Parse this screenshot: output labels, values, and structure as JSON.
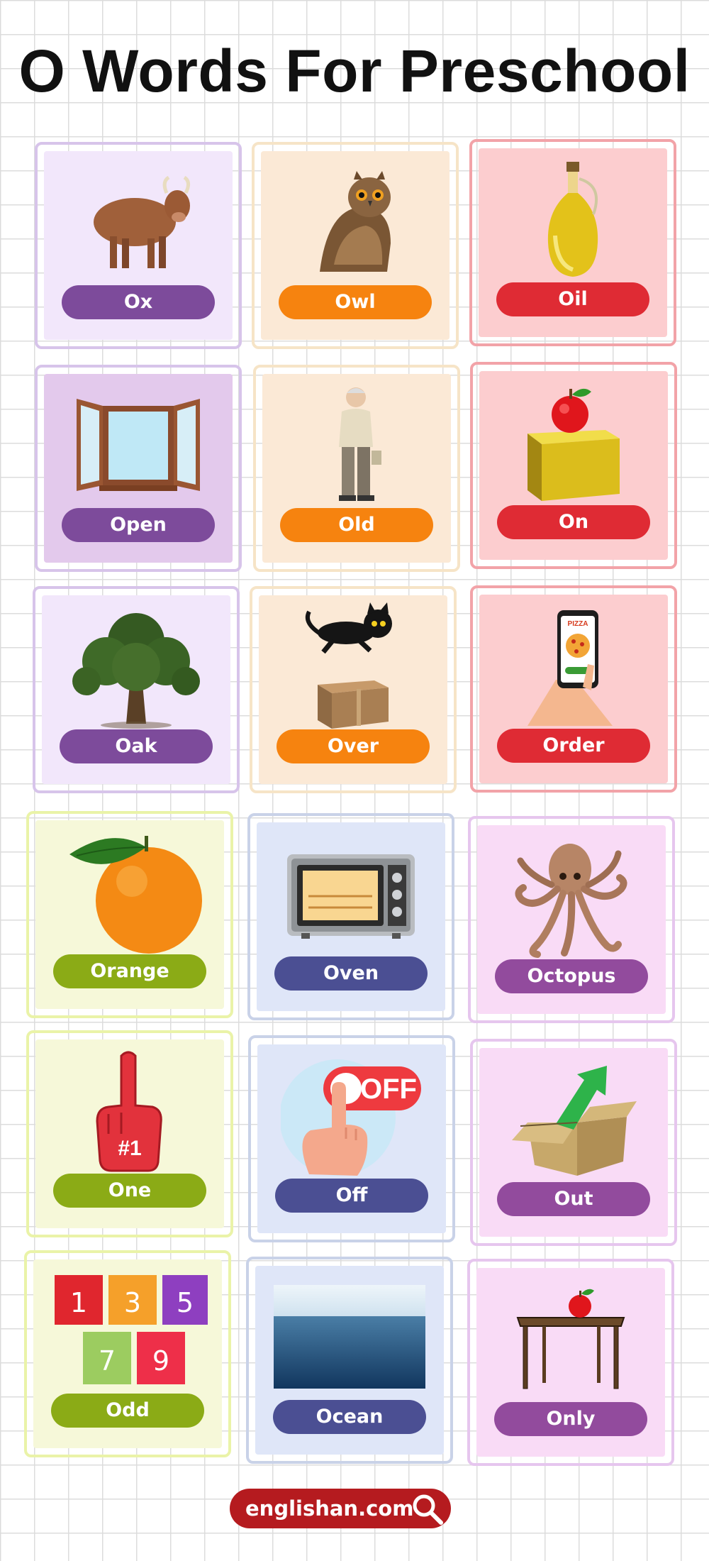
{
  "title": "O Words For Preschool",
  "cards": [
    {
      "word": "Ox",
      "icon": "ox-icon",
      "theme": "purple"
    },
    {
      "word": "Owl",
      "icon": "owl-icon",
      "theme": "peach"
    },
    {
      "word": "Oil",
      "icon": "oil-bottle-icon",
      "theme": "red"
    },
    {
      "word": "Open",
      "icon": "open-window-icon",
      "theme": "purple"
    },
    {
      "word": "Old",
      "icon": "old-man-icon",
      "theme": "peach"
    },
    {
      "word": "On",
      "icon": "apple-on-box-icon",
      "theme": "red"
    },
    {
      "word": "Oak",
      "icon": "oak-tree-icon",
      "theme": "purple"
    },
    {
      "word": "Over",
      "icon": "cat-over-box-icon",
      "theme": "peach"
    },
    {
      "word": "Order",
      "icon": "phone-order-icon",
      "theme": "red"
    },
    {
      "word": "Orange",
      "icon": "orange-icon",
      "theme": "green"
    },
    {
      "word": "Oven",
      "icon": "oven-icon",
      "theme": "blue"
    },
    {
      "word": "Octopus",
      "icon": "octopus-icon",
      "theme": "pink"
    },
    {
      "word": "One",
      "icon": "foam-finger-icon",
      "theme": "green"
    },
    {
      "word": "Off",
      "icon": "off-button-icon",
      "theme": "blue"
    },
    {
      "word": "Out",
      "icon": "out-of-box-icon",
      "theme": "pink"
    },
    {
      "word": "Odd",
      "icon": "odd-numbers-icon",
      "theme": "green"
    },
    {
      "word": "Ocean",
      "icon": "ocean-icon",
      "theme": "blue"
    },
    {
      "word": "Only",
      "icon": "table-apple-icon",
      "theme": "pink"
    }
  ],
  "art_text": {
    "foam_finger": "#1",
    "off_button": "OFF",
    "pizza": "PIZZA",
    "odd_numbers": [
      "1",
      "3",
      "5",
      "7",
      "9"
    ]
  },
  "footer": {
    "site": "englishan.com",
    "icon": "search-icon"
  },
  "colors": {
    "purple": "#7d4b9b",
    "peach": "#f6830f",
    "red": "#df2b34",
    "green": "#8bab16",
    "blue": "#4b4f93",
    "pink": "#924b9d",
    "footer": "#b51b1f"
  }
}
